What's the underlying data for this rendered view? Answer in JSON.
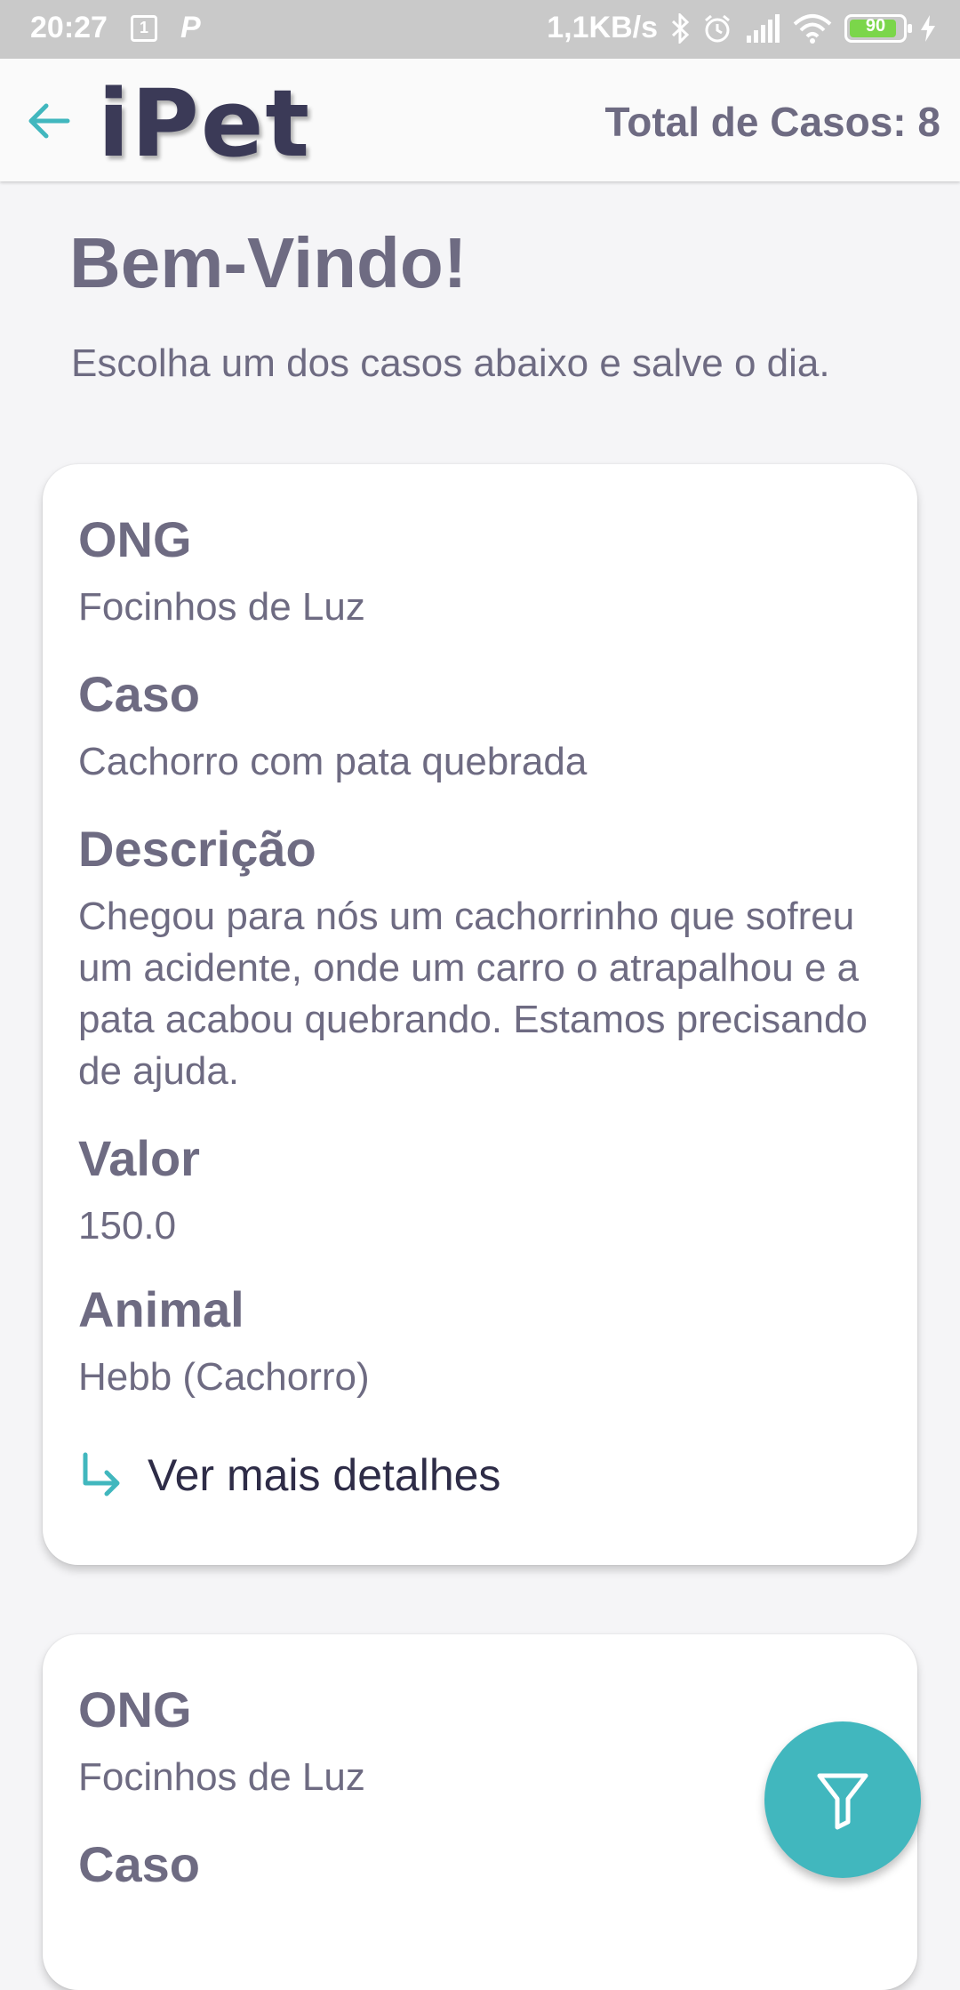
{
  "colors": {
    "background": "#f5f5f7",
    "accent": "#41b7be",
    "text": "#6e6b82",
    "header_logo": "#3b3a57"
  },
  "status_bar": {
    "time": "20:27",
    "notification_box": "1",
    "parking_icon_label": "P",
    "network_speed": "1,1KB/s",
    "battery": "90",
    "battery_level": 0.9,
    "icons": [
      "bluetooth-icon",
      "alarm-icon",
      "signal-icon",
      "wifi-icon",
      "battery-icon",
      "charging-icon"
    ]
  },
  "header": {
    "logo": "iPet",
    "total_cases": "Total de Casos: 8",
    "back_icon": "arrow-left-icon"
  },
  "welcome": {
    "title": "Bem-Vindo!",
    "subtitle": "Escolha um dos casos abaixo e salve o dia."
  },
  "cases": [
    {
      "ong_label": "ONG",
      "ong": "Focinhos de Luz",
      "case_label": "Caso",
      "case": "Cachorro com pata quebrada",
      "description_label": "Descrição",
      "description": "Chegou para nós um cachorrinho que sofreu um acidente, onde um carro o atrapalhou e a pata acabou quebrando. Estamos precisando de ajuda.",
      "value_label": "Valor",
      "value": "150.0",
      "animal_label": "Animal",
      "animal": "Hebb (Cachorro)",
      "details_link": "Ver mais detalhes"
    },
    {
      "ong_label": "ONG",
      "ong": "Focinhos de Luz",
      "case_label": "Caso"
    }
  ],
  "fab": {
    "icon": "filter-icon"
  }
}
